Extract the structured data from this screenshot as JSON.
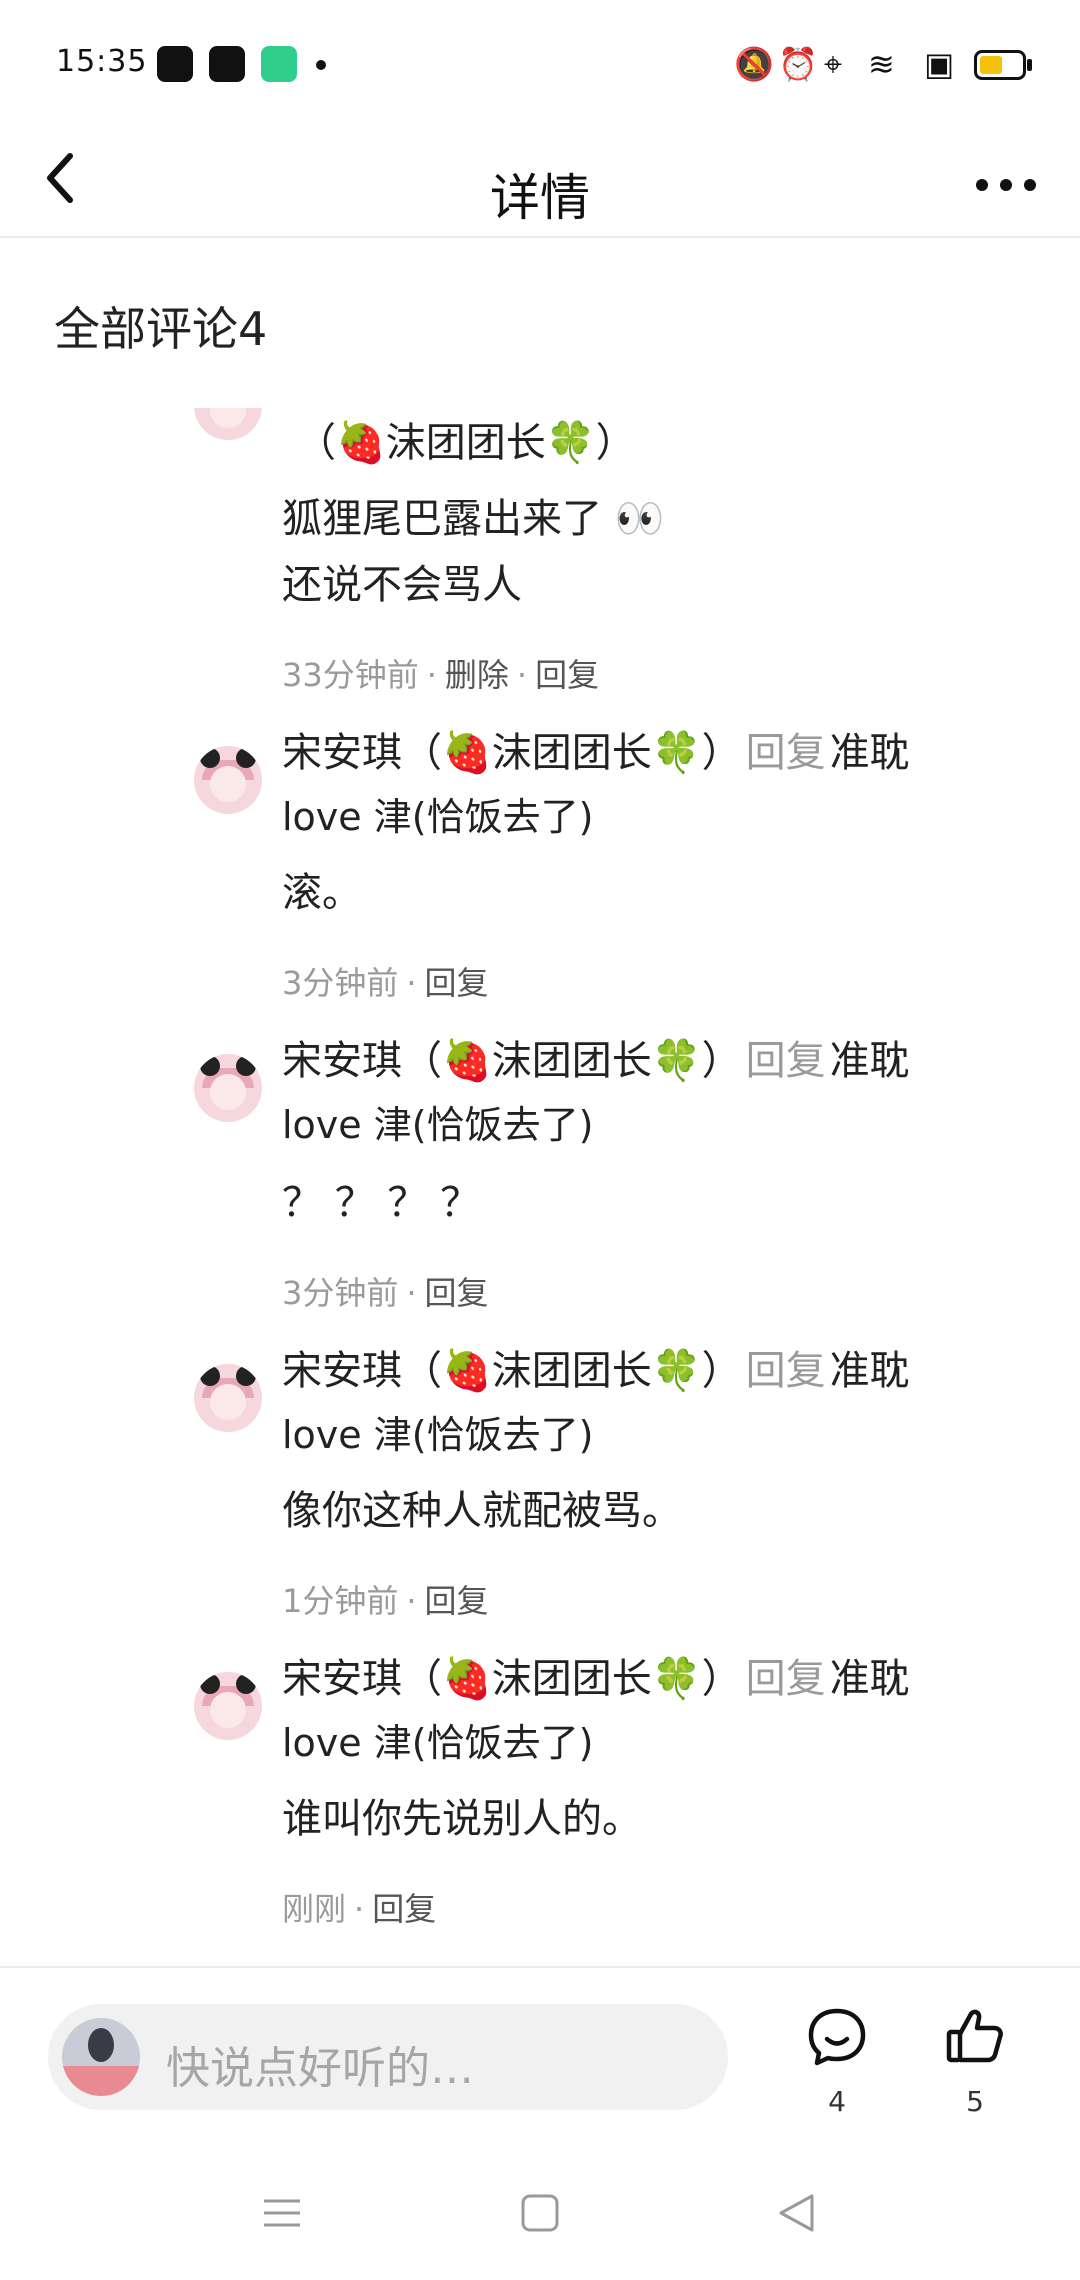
{
  "status": {
    "time": "15:35"
  },
  "nav": {
    "back": "<",
    "title": "详情",
    "more": "•••"
  },
  "section": {
    "title": "全部评论4"
  },
  "first_comment": {
    "name_tail": "（🍓沫团团长🍀）",
    "text_line1": "狐狸尾巴露出来了 👀",
    "text_line2": "还说不会骂人",
    "meta": {
      "time": "33分钟前",
      "delete": "删除",
      "reply": "回复"
    }
  },
  "replies": [
    {
      "author": "宋安琪（🍓沫团团长🍀）",
      "reply_word": "回复",
      "target_part1": "准耽",
      "target_part2": "love 津(恰饭去了)",
      "text": "滚。",
      "meta_time": "3分钟前",
      "meta_reply": "回复"
    },
    {
      "author": "宋安琪（🍓沫团团长🍀）",
      "reply_word": "回复",
      "target_part1": "准耽",
      "target_part2": "love 津(恰饭去了)",
      "text": "？ ？ ？ ？",
      "meta_time": "3分钟前",
      "meta_reply": "回复"
    },
    {
      "author": "宋安琪（🍓沫团团长🍀）",
      "reply_word": "回复",
      "target_part1": "准耽",
      "target_part2": "love 津(恰饭去了)",
      "text": "像你这种人就配被骂。",
      "meta_time": "1分钟前",
      "meta_reply": "回复"
    },
    {
      "author": "宋安琪（🍓沫团团长🍀）",
      "reply_word": "回复",
      "target_part1": "准耽",
      "target_part2": "love 津(恰饭去了)",
      "text": "谁叫你先说别人的。",
      "meta_time": "刚刚",
      "meta_reply": "回复"
    }
  ],
  "bottom": {
    "placeholder": "快说点好听的…",
    "comment_count": "4",
    "like_count": "5"
  },
  "icons": {
    "comment": "comment-bubble-icon",
    "like": "thumbs-up-icon"
  }
}
